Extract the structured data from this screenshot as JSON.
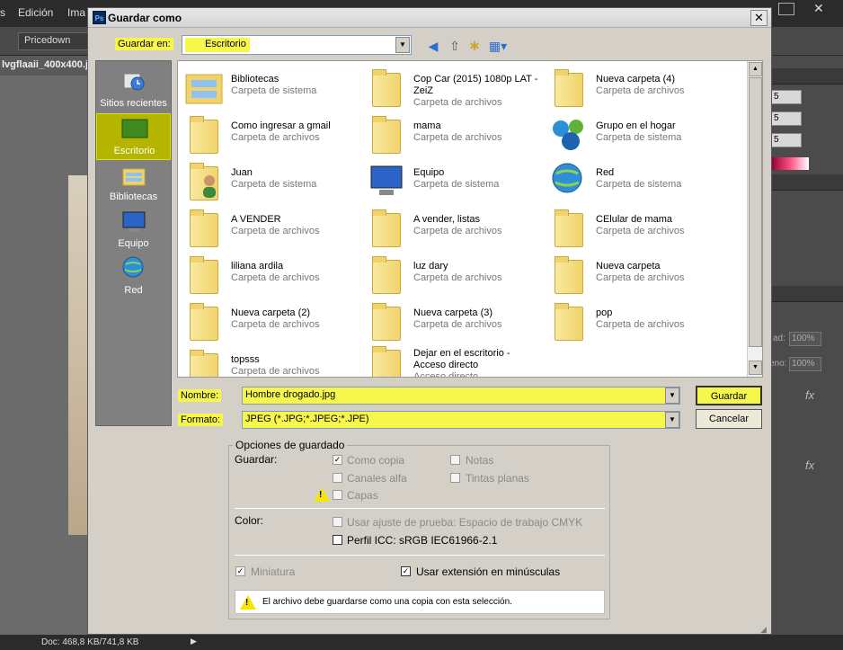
{
  "app": {
    "menu": [
      "Edición",
      "Ima"
    ],
    "preset": "Pricedown",
    "doc_tab": "lvgflaaii_400x400.j",
    "status": "Doc: 468,8 KB/741,8 KB",
    "right_fields": [
      "5",
      "5",
      "5"
    ],
    "right_field_labels": [
      "ad:",
      "eno:"
    ],
    "right_field_values": [
      "100%",
      "100%"
    ],
    "fx": "fx"
  },
  "dialog": {
    "title": "Guardar como",
    "ps_badge": "Ps",
    "close": "✕",
    "save_in_label": "Guardar en:",
    "save_in_value": "Escritorio",
    "places": [
      {
        "label": "Sitios recientes",
        "icon": "recent-places-icon"
      },
      {
        "label": "Escritorio",
        "icon": "desktop-icon"
      },
      {
        "label": "Bibliotecas",
        "icon": "libraries-icon"
      },
      {
        "label": "Equipo",
        "icon": "computer-icon"
      },
      {
        "label": "Red",
        "icon": "network-icon"
      }
    ],
    "files": [
      {
        "name": "Bibliotecas",
        "type": "Carpeta de sistema"
      },
      {
        "name": "Cop Car (2015) 1080p LAT - ZeiZ",
        "type": "Carpeta de archivos"
      },
      {
        "name": "Nueva carpeta (4)",
        "type": "Carpeta de archivos"
      },
      {
        "name": "Como ingresar a gmail",
        "type": "Carpeta de archivos"
      },
      {
        "name": "mama",
        "type": "Carpeta de archivos"
      },
      {
        "name": "Grupo en el hogar",
        "type": "Carpeta de sistema"
      },
      {
        "name": "Juan",
        "type": "Carpeta de sistema"
      },
      {
        "name": "Equipo",
        "type": "Carpeta de sistema"
      },
      {
        "name": "Red",
        "type": "Carpeta de sistema"
      },
      {
        "name": "A VENDER",
        "type": "Carpeta de archivos"
      },
      {
        "name": "A vender, listas",
        "type": "Carpeta de archivos"
      },
      {
        "name": "CElular de mama",
        "type": "Carpeta de archivos"
      },
      {
        "name": "liliana ardila",
        "type": "Carpeta de archivos"
      },
      {
        "name": "luz dary",
        "type": "Carpeta de archivos"
      },
      {
        "name": "Nueva carpeta",
        "type": "Carpeta de archivos"
      },
      {
        "name": "Nueva carpeta (2)",
        "type": "Carpeta de archivos"
      },
      {
        "name": "Nueva carpeta (3)",
        "type": "Carpeta de archivos"
      },
      {
        "name": "pop",
        "type": "Carpeta de archivos"
      },
      {
        "name": "topsss",
        "type": "Carpeta de archivos"
      },
      {
        "name": "Dejar en el escritorio - Acceso directo",
        "type": "Acceso directo"
      }
    ],
    "name_label": "Nombre:",
    "name_value": "Hombre drogado.jpg",
    "format_label": "Formato:",
    "format_value": "JPEG (*.JPG;*.JPEG;*.JPE)",
    "save_button": "Guardar",
    "cancel_button": "Cancelar",
    "options": {
      "legend": "Opciones de guardado",
      "save_label": "Guardar:",
      "como_copia": "Como copia",
      "notas": "Notas",
      "canales_alfa": "Canales alfa",
      "tintas_planas": "Tintas planas",
      "capas": "Capas",
      "color_label": "Color:",
      "usar_ajuste": "Usar ajuste de prueba: Espacio de trabajo CMYK",
      "perfil_icc": "Perfil ICC: sRGB IEC61966-2.1",
      "miniatura": "Miniatura",
      "usar_extension": "Usar extensión en minúsculas",
      "warning": "El archivo debe guardarse como una copia con esta selección."
    }
  }
}
